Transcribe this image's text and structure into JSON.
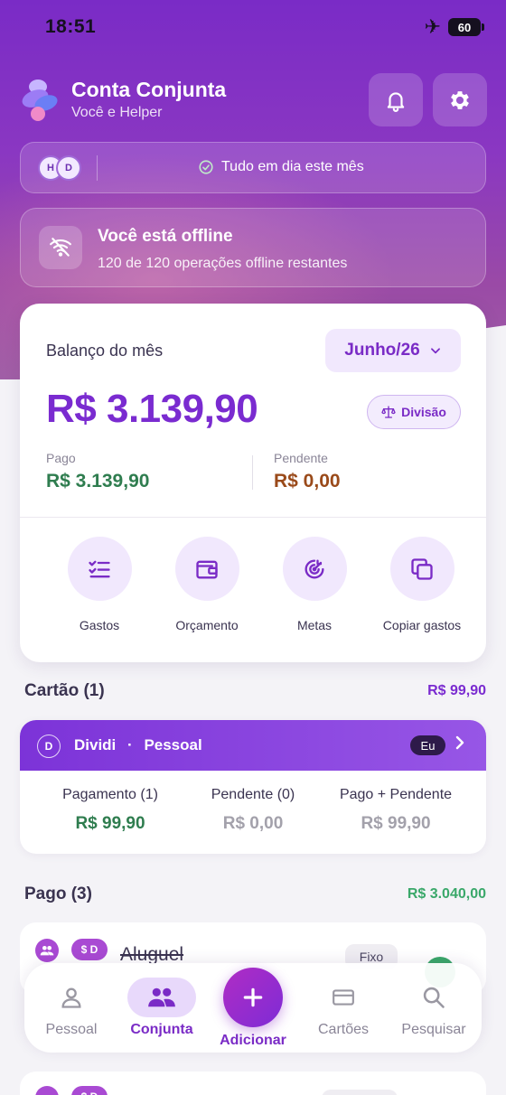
{
  "status_bar": {
    "time": "18:51",
    "battery": "60"
  },
  "header": {
    "title": "Conta Conjunta",
    "subtitle": "Você e Helper"
  },
  "sync": {
    "avatar_1": "H",
    "avatar_2": "D",
    "text": "Tudo em dia este mês"
  },
  "offline": {
    "title": "Você está offline",
    "subtitle": "120 de 120 operações offline restantes"
  },
  "balance": {
    "label": "Balanço do mês",
    "month": "Junho/26",
    "value": "R$ 3.139,90",
    "division_label": "Divisão",
    "paid_label": "Pago",
    "paid_value": "R$ 3.139,90",
    "pending_label": "Pendente",
    "pending_value": "R$ 0,00"
  },
  "actions": [
    {
      "label": "Gastos",
      "icon": "checklist-icon"
    },
    {
      "label": "Orçamento",
      "icon": "wallet-icon"
    },
    {
      "label": "Metas",
      "icon": "target-icon"
    },
    {
      "label": "Copiar gastos",
      "icon": "copy-icon"
    }
  ],
  "cards_section": {
    "title": "Cartão (1)",
    "total": "R$ 99,90",
    "card": {
      "avatar": "D",
      "name": "Dividi",
      "separator": "·",
      "type": "Pessoal",
      "owner_badge": "Eu",
      "columns": [
        {
          "header": "Pagamento (1)",
          "value": "R$ 99,90"
        },
        {
          "header": "Pendente (0)",
          "value": "R$ 0,00"
        },
        {
          "header": "Pago + Pendente",
          "value": "R$ 99,90"
        }
      ]
    }
  },
  "paid_section": {
    "title": "Pago (3)",
    "total": "R$ 3.040,00",
    "item": {
      "badge": "$ D",
      "name": "Aluguel",
      "tag": "Fixo"
    },
    "item2": {
      "badge": "$ D"
    }
  },
  "bottom_nav": {
    "items": [
      {
        "label": "Pessoal",
        "icon": "person-icon"
      },
      {
        "label": "Conjunta",
        "icon": "group-icon"
      },
      {
        "label": "Cartões",
        "icon": "credit-card-icon"
      },
      {
        "label": "Pesquisar",
        "icon": "search-icon"
      }
    ],
    "add_label": "Adicionar"
  },
  "colors": {
    "accent": "#7a2bd0",
    "paid_green": "#2f7d4f",
    "pending_brown": "#9a4a1a",
    "muted_gray": "#9a98a2",
    "total_green": "#3aa86a"
  }
}
